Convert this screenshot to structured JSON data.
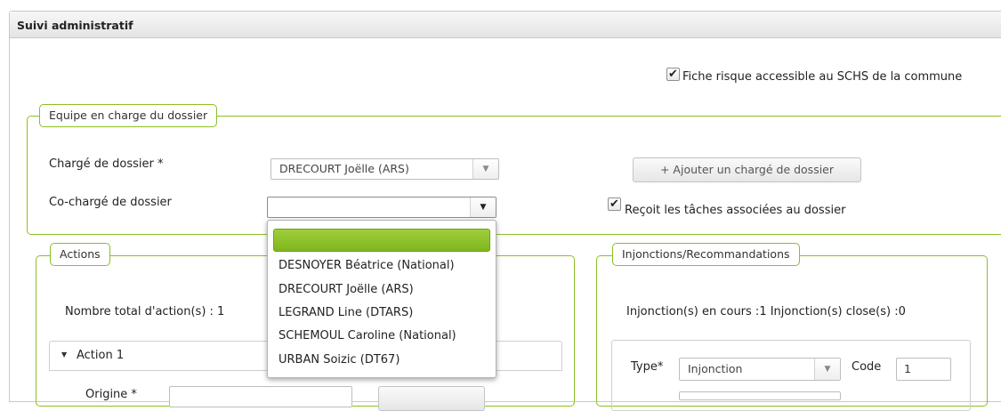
{
  "panel": {
    "title": "Suivi administratif"
  },
  "fiche_risque": {
    "checked": true,
    "label": "Fiche risque accessible au SCHS de la commune"
  },
  "equipe": {
    "legend": "Equipe en charge du dossier",
    "charge_label": "Chargé de dossier *",
    "charge_value": "DRECOURT Joëlle (ARS)",
    "cocharge_label": "Co-chargé de dossier",
    "cocharge_value": "",
    "add_button": "+ Ajouter un chargé de dossier",
    "recoit": {
      "checked": true,
      "label": "Reçoit les tâches associées au dossier"
    }
  },
  "dropdown": {
    "options": [
      "",
      "DESNOYER Béatrice (National)",
      "DRECOURT Joëlle (ARS)",
      "LEGRAND Line (DTARS)",
      "SCHEMOUL Caroline (National)",
      "URBAN Soizic (DT67)"
    ]
  },
  "actions": {
    "legend": "Actions",
    "total_label": "Nombre total d'action(s) : 1",
    "action1_label": "Action 1",
    "origine_label": "Origine *"
  },
  "injonctions": {
    "legend": "Injonctions/Recommandations",
    "summary": "Injonction(s) en cours :1  Injonction(s) close(s) :0",
    "type_label": "Type*",
    "type_value": "Injonction",
    "code_label": "Code",
    "code_value": "1"
  },
  "icons": {
    "check": "✔",
    "caret_down": "▼",
    "triangle_down": "▼"
  },
  "colors": {
    "accent_green": "#8cbf26",
    "highlight_green": "#8fc32b"
  }
}
